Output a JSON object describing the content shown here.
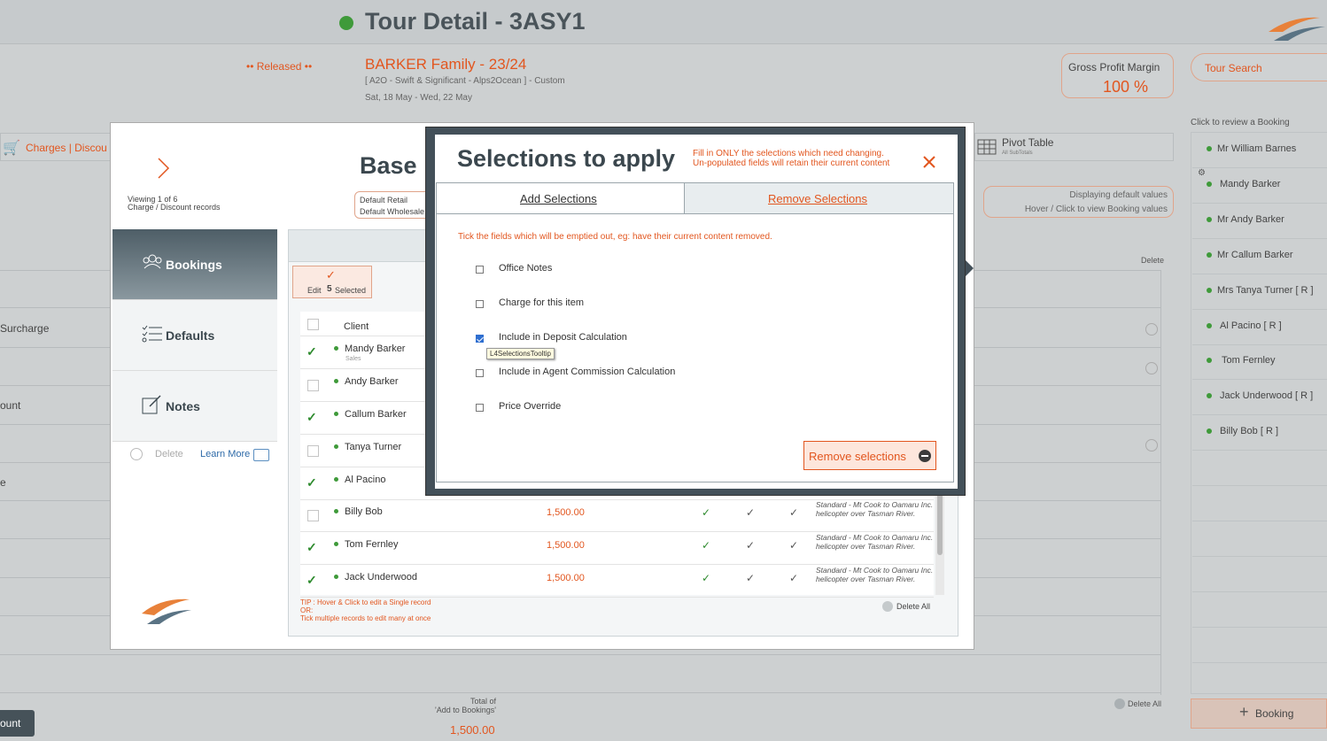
{
  "header": {
    "title": "Tour Detail - 3ASY1",
    "status": "•• Released ••",
    "tour_name": "BARKER Family - 23/24",
    "tour_meta": "[ A2O - Swift & Significant - Alps2Ocean ] - Custom",
    "tour_dates": "Sat, 18 May  - Wed, 22 May",
    "gpm_label": "Gross Profit Margin",
    "gpm_value": "100 %",
    "search_placeholder": "Tour Search"
  },
  "background": {
    "charges_tab": "Charges | Discou",
    "pivot_label": "Pivot Table",
    "pivot_sub": "All SubTotals",
    "display_note_1": "Displaying default values",
    "display_note_2": "Hover / Click to view Booking values",
    "delete_header": "Delete",
    "left_labels": [
      "Surcharge",
      "ount",
      "e"
    ],
    "bottom_button": "ount",
    "total_label_1": "Total of",
    "total_label_2": "'Add to Bookings'",
    "total_value": "1,500.00",
    "delete_all": "Delete All"
  },
  "sidebar": {
    "heading": "Click to review a Booking",
    "items": [
      {
        "label": "Mr William Barnes"
      },
      {
        "label": "Mandy Barker"
      },
      {
        "label": "Mr Andy Barker"
      },
      {
        "label": "Mr Callum Barker"
      },
      {
        "label": "Mrs Tanya Turner  [ R ]"
      },
      {
        "label": "Al Pacino  [ R ]"
      },
      {
        "label": "Tom Fernley"
      },
      {
        "label": "Jack Underwood  [ R ]"
      },
      {
        "label": "Billy Bob  [ R ]"
      }
    ],
    "add_booking": "Booking"
  },
  "modal": {
    "viewing": "Viewing 1 of 6",
    "records": "Charge / Discount records",
    "title_partial": "Base",
    "default_retail": "Default Retail",
    "default_wholesale": "Default Wholesale",
    "tabs": [
      {
        "label": "Bookings"
      },
      {
        "label": "Defaults"
      },
      {
        "label": "Notes"
      }
    ],
    "delete": "Delete",
    "learn_more": "Learn More",
    "edit_count": "5",
    "edit_prefix": "Edit",
    "edit_suffix": "Selected",
    "client_header": "Client",
    "rows": [
      {
        "name": "Mandy Barker",
        "sub": "Sales",
        "checked": true
      },
      {
        "name": "Andy Barker",
        "checked": false
      },
      {
        "name": "Callum Barker",
        "checked": true
      },
      {
        "name": "Tanya Turner",
        "checked": false
      },
      {
        "name": "Al Pacino",
        "checked": true
      },
      {
        "name": "Billy Bob",
        "amount": "1,500.00",
        "desc": "Standard - Mt Cook to Oamaru Inc. helicopter over Tasman River.",
        "checked": false
      },
      {
        "name": "Tom Fernley",
        "amount": "1,500.00",
        "desc": "Standard - Mt Cook to Oamaru Inc. helicopter over Tasman River.",
        "checked": true
      },
      {
        "name": "Jack Underwood",
        "amount": "1,500.00",
        "desc": "Standard - Mt Cook to Oamaru Inc. helicopter over Tasman River.",
        "checked": true
      }
    ],
    "tip_1": "TIP : Hover & Click to edit a Single record",
    "tip_2": "OR:",
    "tip_3": "Tick multiple records to edit many at once",
    "delete_all": "Delete All"
  },
  "selections": {
    "title": "Selections to apply",
    "note_1": "Fill in ONLY the selections which need changing.",
    "note_2": "Un-populated fields will retain their current content",
    "tab_add": "Add Selections",
    "tab_remove": "Remove Selections",
    "instruction": "Tick the fields which will be emptied out, eg: have their current content removed.",
    "options": [
      {
        "label": "Office Notes",
        "checked": false
      },
      {
        "label": "Charge for this item",
        "checked": false
      },
      {
        "label": "Include in Deposit Calculation",
        "checked": true
      },
      {
        "label": "Include in Agent Commission Calculation",
        "checked": false
      },
      {
        "label": "Price Override",
        "checked": false
      }
    ],
    "tooltip": "L4SelectionsTooltip",
    "remove_button": "Remove selections"
  },
  "colors": {
    "accent": "#e2561f",
    "dark": "#435059",
    "green": "#3f9a3a"
  }
}
